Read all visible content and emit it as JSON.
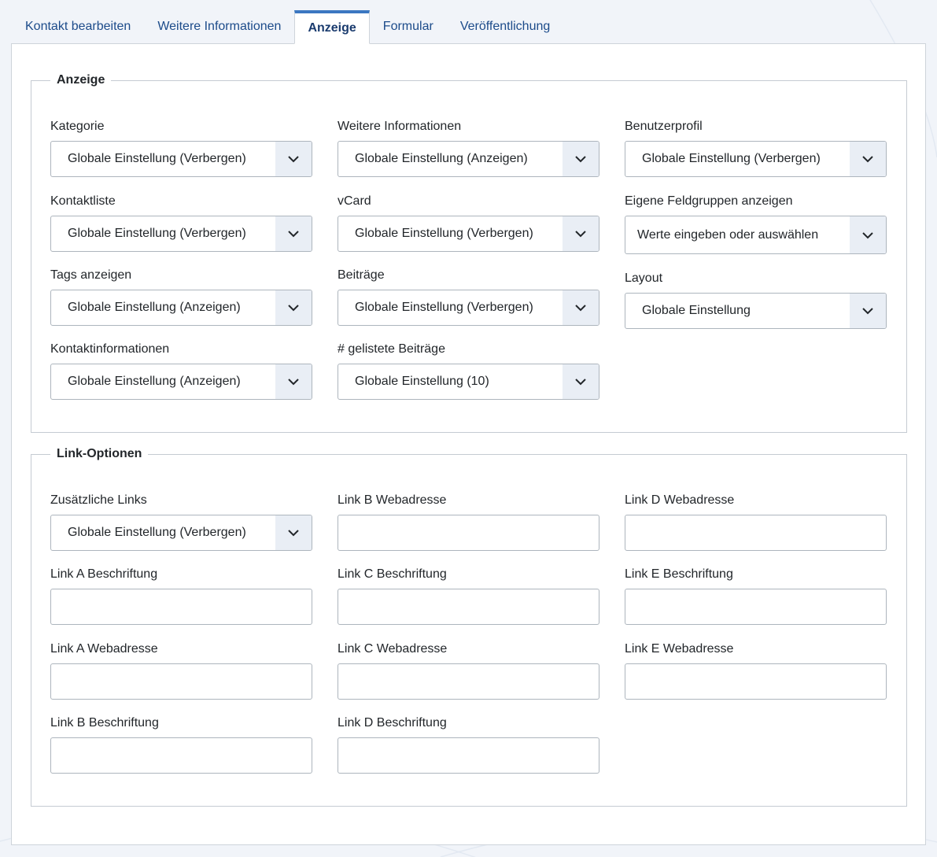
{
  "tabs": [
    {
      "label": "Kontakt bearbeiten",
      "active": false
    },
    {
      "label": "Weitere Informationen",
      "active": false
    },
    {
      "label": "Anzeige",
      "active": true
    },
    {
      "label": "Formular",
      "active": false
    },
    {
      "label": "Veröffentlichung",
      "active": false
    }
  ],
  "anzeige": {
    "legend": "Anzeige",
    "fields": {
      "kategorie": {
        "label": "Kategorie",
        "value": "Globale Einstellung (Verbergen)"
      },
      "weitere_informationen": {
        "label": "Weitere Informationen",
        "value": "Globale Einstellung (Anzeigen)"
      },
      "benutzerprofil": {
        "label": "Benutzerprofil",
        "value": "Globale Einstellung (Verbergen)"
      },
      "kontaktliste": {
        "label": "Kontaktliste",
        "value": "Globale Einstellung (Verbergen)"
      },
      "vcard": {
        "label": "vCard",
        "value": "Globale Einstellung (Verbergen)"
      },
      "feldgruppen": {
        "label": "Eigene Feldgruppen anzeigen",
        "placeholder": "Werte eingeben oder auswählen"
      },
      "tags": {
        "label": "Tags anzeigen",
        "value": "Globale Einstellung (Anzeigen)"
      },
      "beitraege": {
        "label": "Beiträge",
        "value": "Globale Einstellung (Verbergen)"
      },
      "layout": {
        "label": "Layout",
        "value": "Globale Einstellung"
      },
      "kontaktinformationen": {
        "label": "Kontaktinformationen",
        "value": "Globale Einstellung (Anzeigen)"
      },
      "gelistete_beitraege": {
        "label": "# gelistete Beiträge",
        "value": "Globale Einstellung (10)"
      }
    }
  },
  "links": {
    "legend": "Link-Optionen",
    "fields": {
      "zusaetzliche_links": {
        "label": "Zusätzliche Links",
        "value": "Globale Einstellung (Verbergen)"
      },
      "link_a_label": {
        "label": "Link A Beschriftung",
        "value": ""
      },
      "link_a_url": {
        "label": "Link A Webadresse",
        "value": ""
      },
      "link_b_label": {
        "label": "Link B Beschriftung",
        "value": ""
      },
      "link_b_url": {
        "label": "Link B Webadresse",
        "value": ""
      },
      "link_c_label": {
        "label": "Link C Beschriftung",
        "value": ""
      },
      "link_c_url": {
        "label": "Link C Webadresse",
        "value": ""
      },
      "link_d_label": {
        "label": "Link D Beschriftung",
        "value": ""
      },
      "link_d_url": {
        "label": "Link D Webadresse",
        "value": ""
      },
      "link_e_label": {
        "label": "Link E Beschriftung",
        "value": ""
      },
      "link_e_url": {
        "label": "Link E Webadresse",
        "value": ""
      }
    }
  },
  "icons": {
    "select_arrow": "chevron-down-icon"
  },
  "colors": {
    "tab_text": "#1c4b8a",
    "tab_active_bar": "#3b77c1",
    "arrow_bg": "#e9eef5",
    "border": "#adb5bd"
  }
}
